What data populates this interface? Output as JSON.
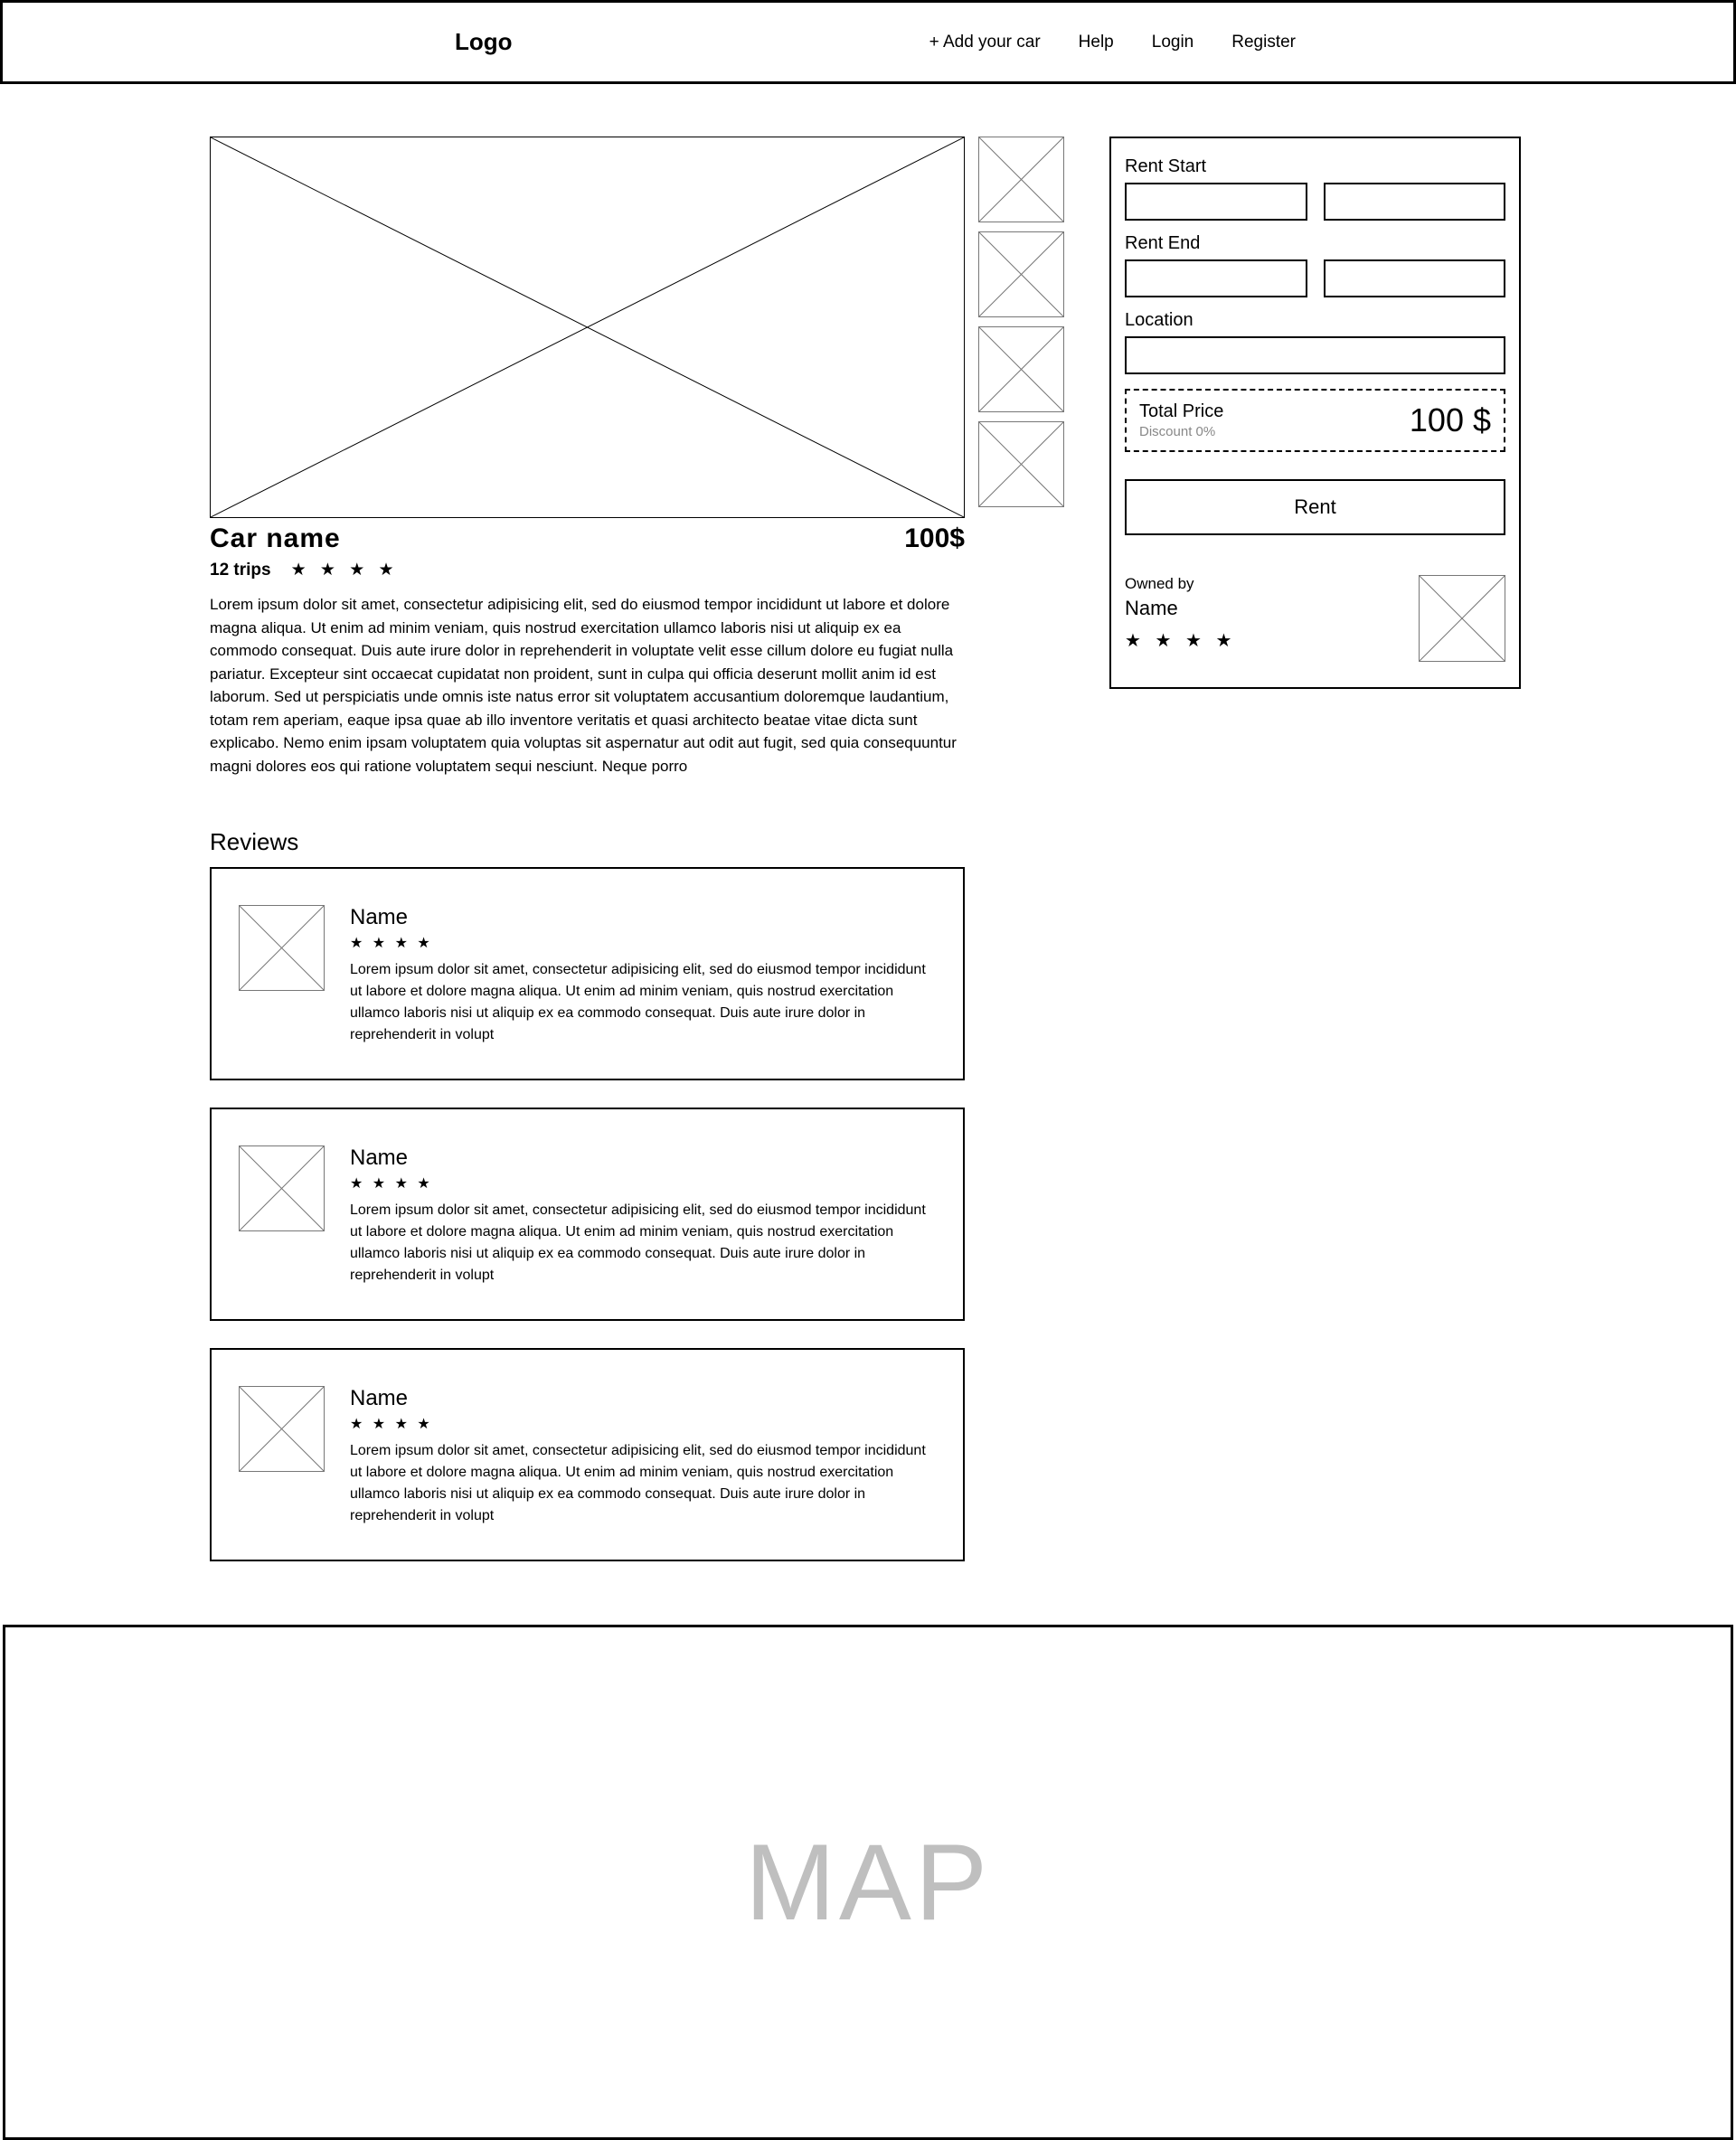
{
  "header": {
    "logo": "Logo",
    "nav": {
      "add_car": "+ Add your car",
      "help": "Help",
      "login": "Login",
      "register": "Register"
    }
  },
  "car": {
    "name": "Car name",
    "price": "100$",
    "trips": "12 trips",
    "stars": "★ ★ ★ ★",
    "description": "Lorem ipsum dolor sit amet, consectetur adipisicing elit, sed do eiusmod tempor incididunt ut labore et dolore magna aliqua. Ut enim ad minim veniam, quis nostrud exercitation ullamco laboris nisi ut aliquip ex ea commodo consequat. Duis aute irure dolor in reprehenderit in voluptate velit esse cillum dolore eu fugiat nulla pariatur. Excepteur sint occaecat cupidatat non proident, sunt in culpa qui officia deserunt mollit anim id est laborum. Sed ut perspiciatis unde omnis iste natus error sit voluptatem accusantium doloremque laudantium, totam rem aperiam, eaque ipsa quae ab illo inventore veritatis et quasi architecto beatae vitae dicta sunt explicabo. Nemo enim ipsam voluptatem quia voluptas sit aspernatur aut odit aut fugit, sed quia consequuntur magni dolores eos qui ratione voluptatem sequi nesciunt. Neque porro"
  },
  "reviews_title": "Reviews",
  "reviews": [
    {
      "name": "Name",
      "stars": "★ ★ ★ ★",
      "text": "Lorem ipsum dolor sit amet, consectetur adipisicing elit, sed do eiusmod tempor incididunt ut labore et dolore magna aliqua. Ut enim ad minim veniam, quis nostrud exercitation ullamco laboris nisi ut aliquip ex ea commodo consequat. Duis aute irure dolor in reprehenderit in volupt"
    },
    {
      "name": "Name",
      "stars": "★ ★ ★ ★",
      "text": "Lorem ipsum dolor sit amet, consectetur adipisicing elit, sed do eiusmod tempor incididunt ut labore et dolore magna aliqua. Ut enim ad minim veniam, quis nostrud exercitation ullamco laboris nisi ut aliquip ex ea commodo consequat. Duis aute irure dolor in reprehenderit in volupt"
    },
    {
      "name": "Name",
      "stars": "★ ★ ★ ★",
      "text": "Lorem ipsum dolor sit amet, consectetur adipisicing elit, sed do eiusmod tempor incididunt ut labore et dolore magna aliqua. Ut enim ad minim veniam, quis nostrud exercitation ullamco laboris nisi ut aliquip ex ea commodo consequat. Duis aute irure dolor in reprehenderit in volupt"
    }
  ],
  "booking": {
    "rent_start_label": "Rent Start",
    "rent_end_label": "Rent End",
    "location_label": "Location",
    "total_price_label": "Total Price",
    "discount_label": "Discount 0%",
    "total_price_value": "100 $",
    "rent_button": "Rent"
  },
  "owner": {
    "owned_by_label": "Owned by",
    "name": "Name",
    "stars": "★ ★ ★ ★"
  },
  "map": {
    "label": "MAP"
  }
}
